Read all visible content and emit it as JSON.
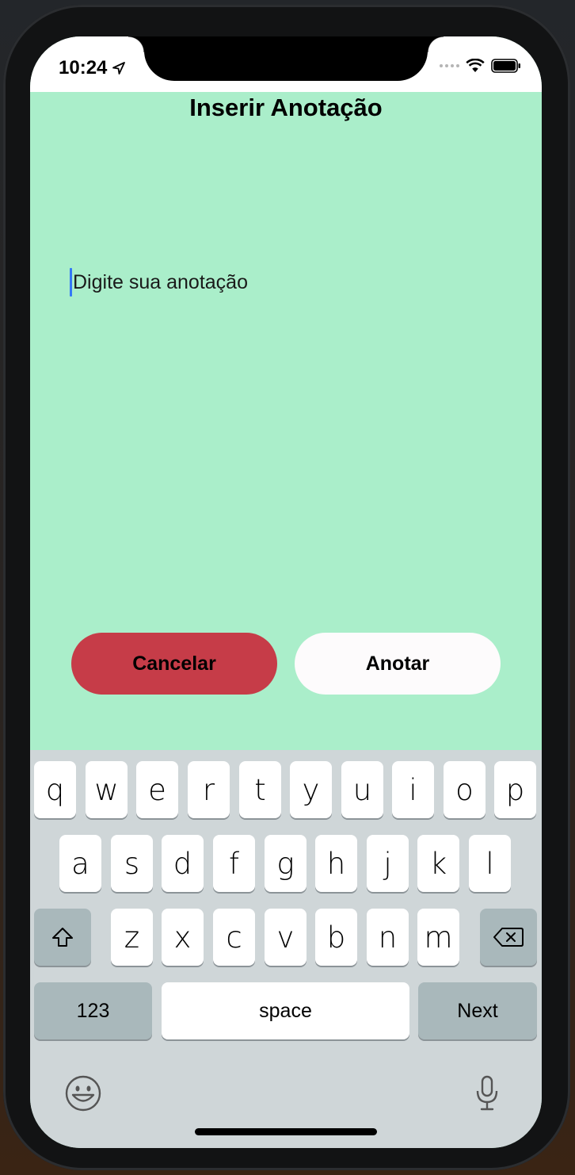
{
  "status_bar": {
    "time": "10:24",
    "icons": [
      "location-arrow-icon",
      "signal-dots-icon",
      "wifi-icon",
      "battery-icon"
    ]
  },
  "page": {
    "title": "Inserir Anotação"
  },
  "note_input": {
    "placeholder": "Digite sua anotação",
    "value": ""
  },
  "buttons": {
    "cancel_label": "Cancelar",
    "submit_label": "Anotar"
  },
  "colors": {
    "background": "#aaeeca",
    "cancel_button": "#c63c48",
    "submit_button": "#fdfbfc",
    "caret": "#3478f6"
  },
  "keyboard": {
    "row1": [
      "q",
      "w",
      "e",
      "r",
      "t",
      "y",
      "u",
      "i",
      "o",
      "p"
    ],
    "row2": [
      "a",
      "s",
      "d",
      "f",
      "g",
      "h",
      "j",
      "k",
      "l"
    ],
    "row3": [
      "z",
      "x",
      "c",
      "v",
      "b",
      "n",
      "m"
    ],
    "numbers_label": "123",
    "space_label": "space",
    "return_label": "Next",
    "icons": [
      "shift-icon",
      "backspace-icon",
      "emoji-icon",
      "microphone-icon"
    ]
  }
}
